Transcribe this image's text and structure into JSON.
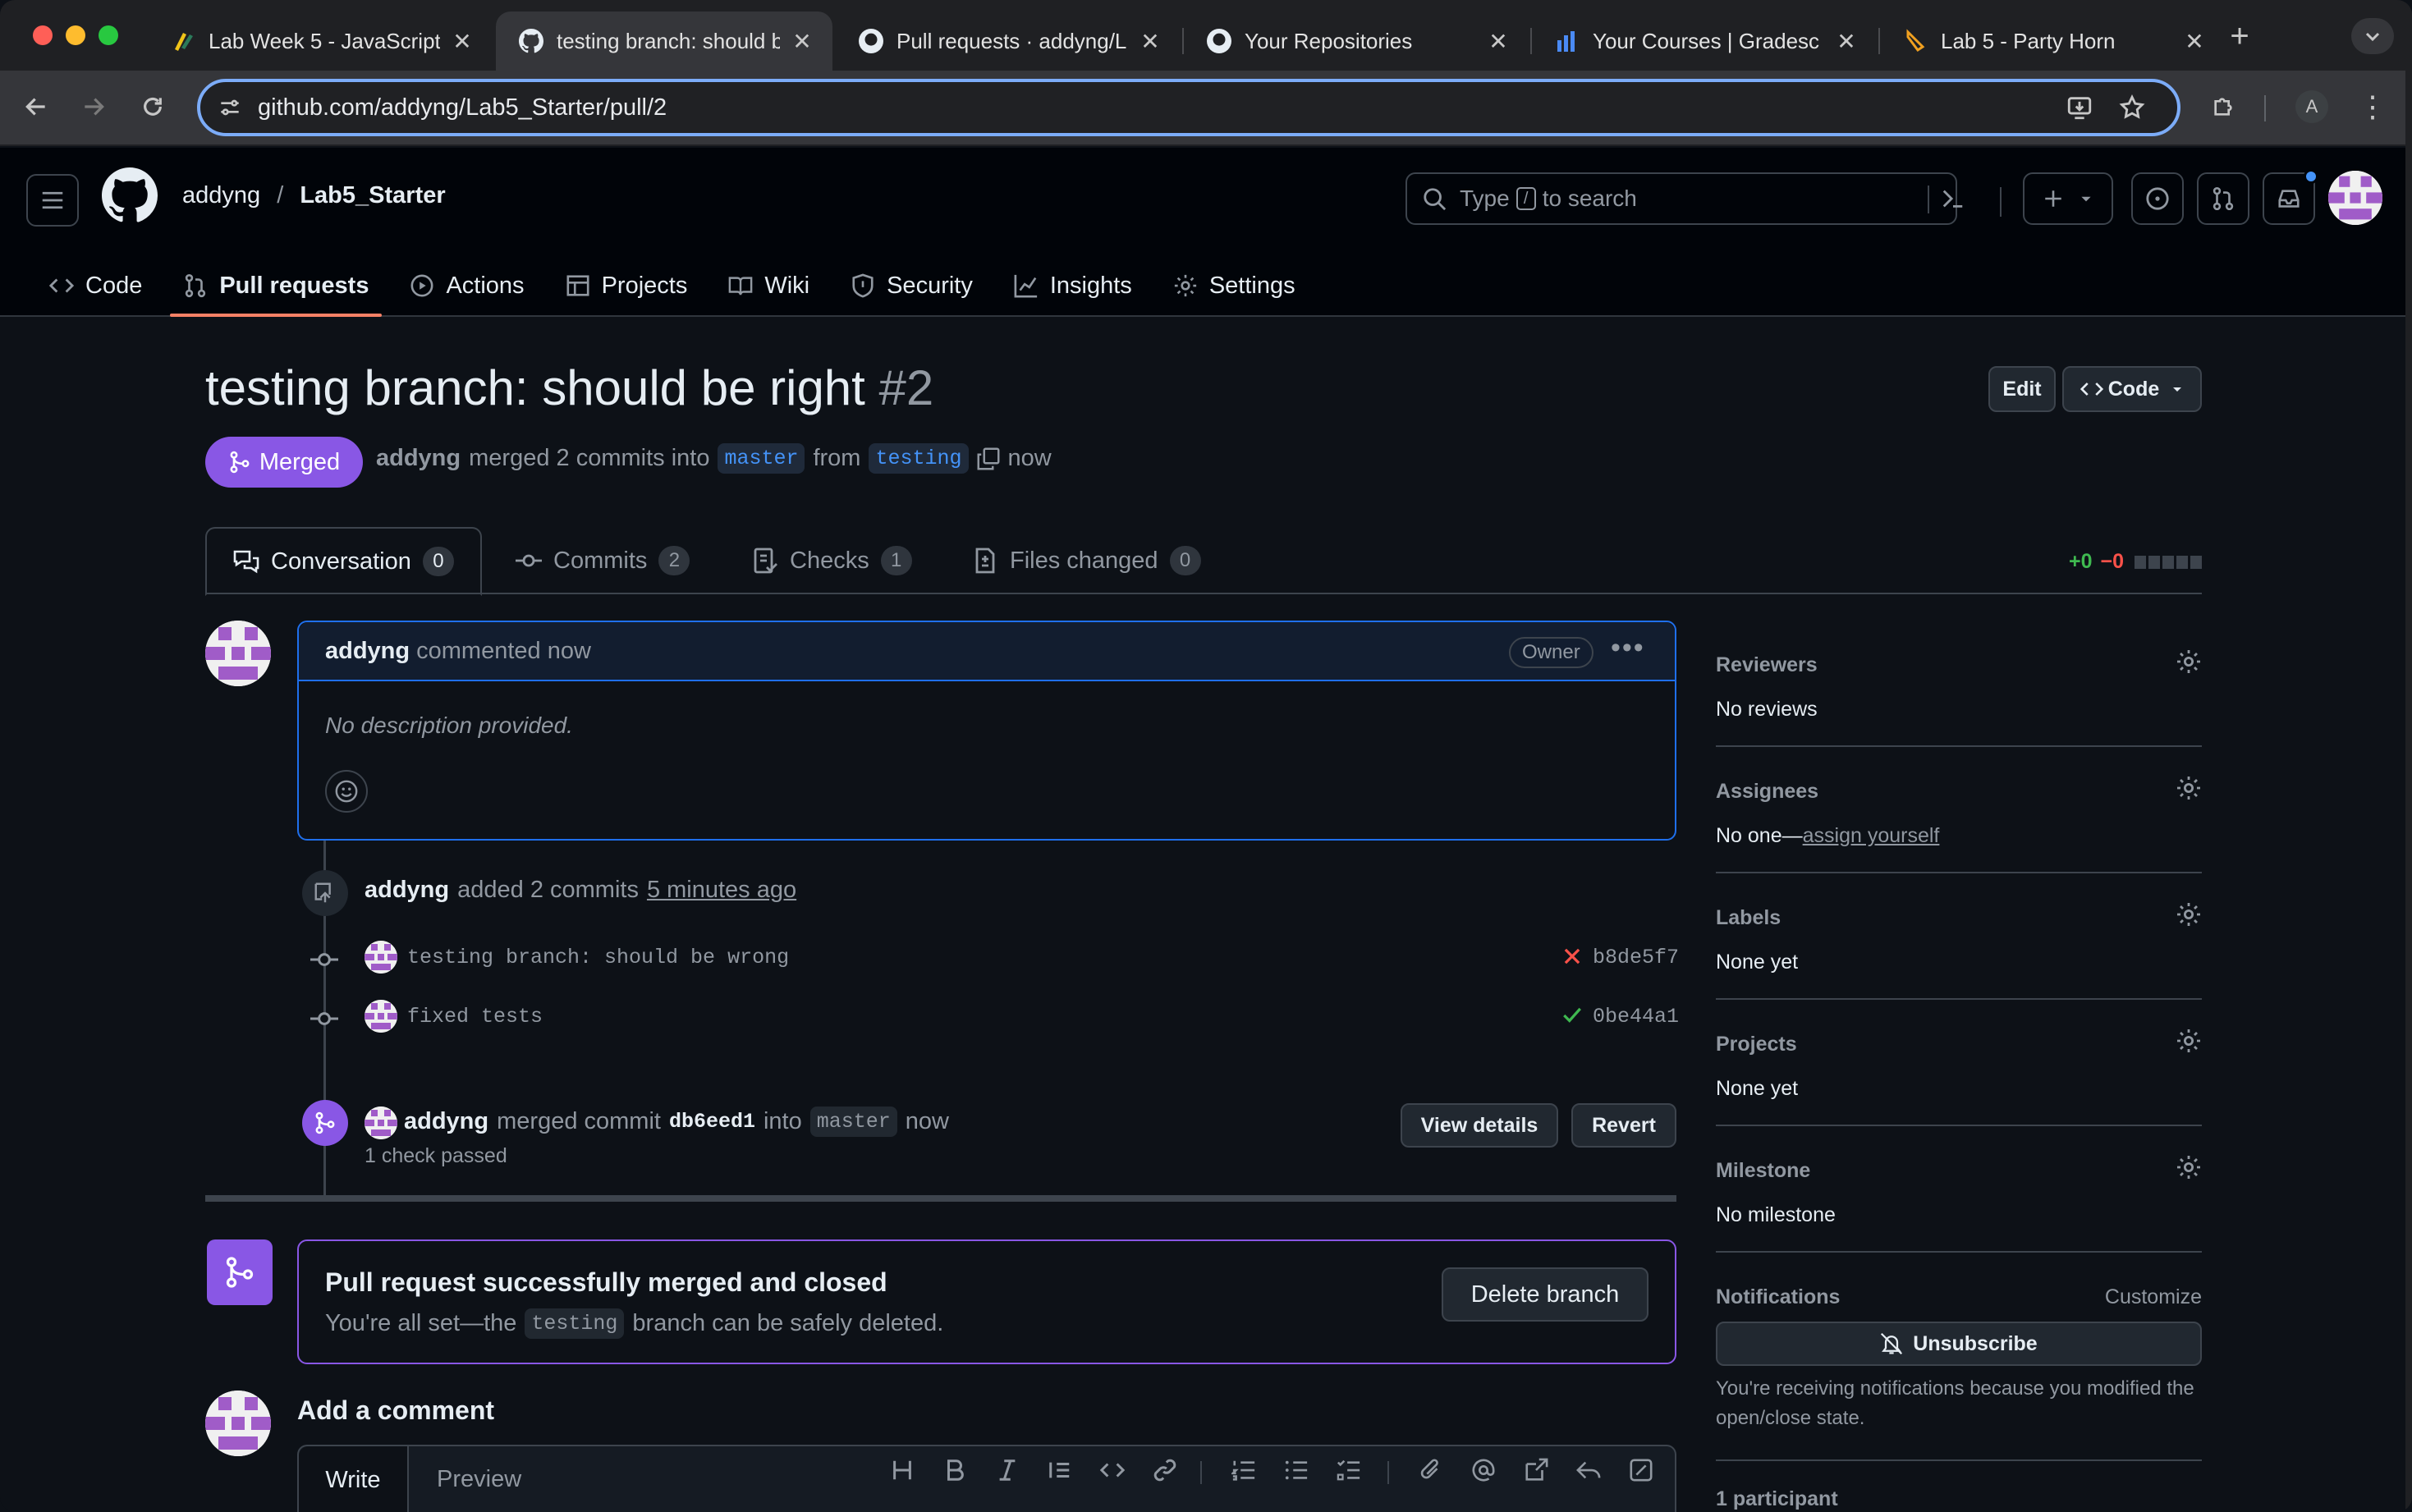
{
  "browser": {
    "tabs": [
      {
        "title": "Lab Week 5 - JavaScript",
        "icon": "lab-icon"
      },
      {
        "title": "testing branch: should b",
        "icon": "github-icon",
        "active": true
      },
      {
        "title": "Pull requests · addyng/L",
        "icon": "github-icon"
      },
      {
        "title": "Your Repositories",
        "icon": "github-icon"
      },
      {
        "title": "Your Courses | Gradesc",
        "icon": "gradescope-icon"
      },
      {
        "title": "Lab 5 - Party Horn",
        "icon": "horn-icon"
      }
    ],
    "url": "github.com/addyng/Lab5_Starter/pull/2",
    "profile_letter": "A"
  },
  "github": {
    "owner": "addyng",
    "separator": "/",
    "repo": "Lab5_Starter",
    "search": {
      "prefix": "Type",
      "key": "/",
      "suffix": "to search"
    },
    "nav": [
      "Code",
      "Pull requests",
      "Actions",
      "Projects",
      "Wiki",
      "Security",
      "Insights",
      "Settings"
    ]
  },
  "pr": {
    "title": "testing branch: should be right",
    "number": "#2",
    "edit_label": "Edit",
    "code_label": "Code",
    "state": "Merged",
    "author": "addyng",
    "merged_text": "merged 2 commits into",
    "base": "master",
    "from_text": "from",
    "head": "testing",
    "time": "now",
    "tabs": [
      {
        "label": "Conversation",
        "count": "0"
      },
      {
        "label": "Commits",
        "count": "2"
      },
      {
        "label": "Checks",
        "count": "1"
      },
      {
        "label": "Files changed",
        "count": "0"
      }
    ],
    "diff_add": "+0",
    "diff_del": "−0"
  },
  "comment": {
    "author": "addyng",
    "action": "commented now",
    "badge": "Owner",
    "body": "No description provided."
  },
  "timeline": {
    "added_author": "addyng",
    "added_text": "added 2 commits",
    "added_time": "5 minutes ago",
    "commits": [
      {
        "message": "testing branch: should be wrong",
        "status": "fail",
        "sha": "b8de5f7"
      },
      {
        "message": "fixed tests",
        "status": "pass",
        "sha": "0be44a1"
      }
    ],
    "merge_author": "addyng",
    "merge_text": "merged commit",
    "merge_sha": "db6eed1",
    "merge_into": "into",
    "merge_base": "master",
    "merge_time": "now",
    "checks": "1 check passed",
    "view_details": "View details",
    "revert": "Revert"
  },
  "mergebox": {
    "title": "Pull request successfully merged and closed",
    "desc_prefix": "You're all set—the",
    "branch": "testing",
    "desc_suffix": "branch can be safely deleted.",
    "delete_label": "Delete branch"
  },
  "add_comment": {
    "title": "Add a comment",
    "write": "Write",
    "preview": "Preview"
  },
  "sidebar": {
    "reviewers": {
      "label": "Reviewers",
      "value": "No reviews"
    },
    "assignees": {
      "label": "Assignees",
      "value": "No one—",
      "link": "assign yourself"
    },
    "labels": {
      "label": "Labels",
      "value": "None yet"
    },
    "projects": {
      "label": "Projects",
      "value": "None yet"
    },
    "milestone": {
      "label": "Milestone",
      "value": "No milestone"
    },
    "notifications": {
      "label": "Notifications",
      "customize": "Customize",
      "button": "Unsubscribe",
      "note": "You're receiving notifications because you modified the open/close state."
    },
    "participants": "1 participant"
  },
  "colors": {
    "accent": "#8957e5",
    "link": "#4493f8",
    "success": "#3fb950",
    "danger": "#f85149"
  }
}
